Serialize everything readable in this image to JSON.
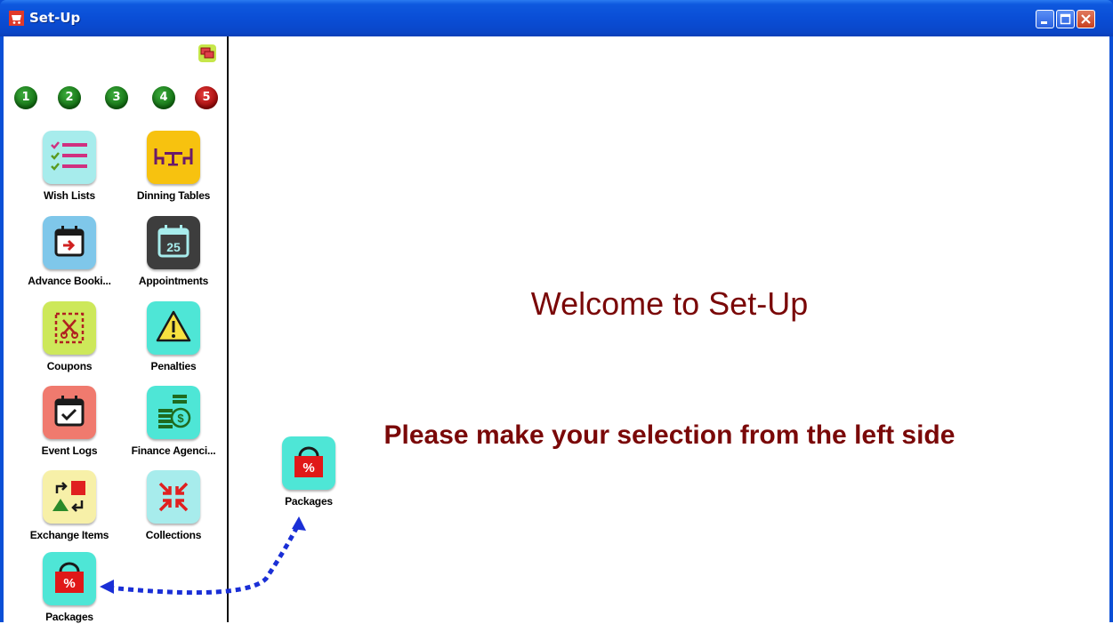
{
  "window": {
    "title": "Set-Up"
  },
  "colors": {
    "titlebar": "#0a4ed6",
    "heading_text": "#7a0808",
    "page_active": "#b00000",
    "page_inactive": "#1a7f1a",
    "arrow": "#1a2fd6"
  },
  "sidebar": {
    "pages": [
      "1",
      "2",
      "3",
      "4",
      "5"
    ],
    "active_page": "5",
    "items": [
      {
        "label": "Wish Lists",
        "icon": "checklist-icon",
        "color": "#a7ecec"
      },
      {
        "label": "Dinning Tables",
        "icon": "dining-table-icon",
        "color": "#f7c20f"
      },
      {
        "label": "Advance Booki...",
        "icon": "calendar-arrow-icon",
        "color": "#7fc7ea"
      },
      {
        "label": "Appointments",
        "icon": "calendar-25-icon",
        "color": "#3d3d3d"
      },
      {
        "label": "Coupons",
        "icon": "coupon-scissors-icon",
        "color": "#cde85a"
      },
      {
        "label": "Penalties",
        "icon": "warning-icon",
        "color": "#4ee6d6"
      },
      {
        "label": "Event Logs",
        "icon": "calendar-check-icon",
        "color": "#f07a6e"
      },
      {
        "label": "Finance Agenci...",
        "icon": "money-stack-icon",
        "color": "#4ee6d6"
      },
      {
        "label": "Exchange Items",
        "icon": "exchange-shapes-icon",
        "color": "#f7f0a8"
      },
      {
        "label": "Collections",
        "icon": "collapse-arrows-icon",
        "color": "#a7ecec"
      },
      {
        "label": "Packages",
        "icon": "percent-bag-icon",
        "color": "#4ee6d6"
      }
    ]
  },
  "main": {
    "welcome": "Welcome to Set-Up",
    "instruction": "Please make your selection from the left side",
    "dragged_item": {
      "label": "Packages",
      "icon": "percent-bag-icon"
    }
  }
}
